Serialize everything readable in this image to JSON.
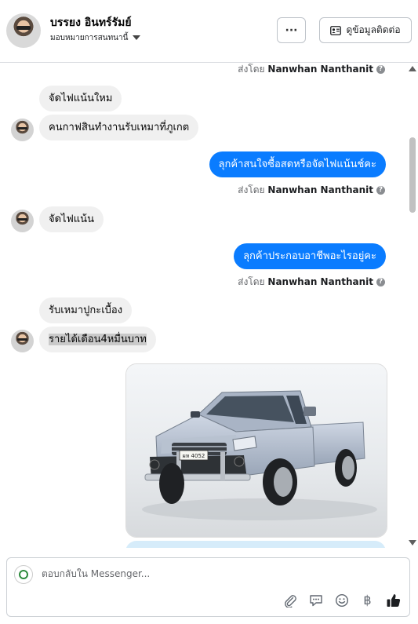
{
  "header": {
    "name": "บรรยง อินทร์รัมย์",
    "assigned_label": "มอบหมายการสนทนานี้",
    "more_label": "···",
    "contact_label": "ดูข้อมูลติดต่อ"
  },
  "messages": {
    "sent_prefix": "ส่งโดย",
    "sender": "Nanwhan Nanthanit",
    "info_glyph": "?",
    "m1": "จัดไฟแน้นใหม",
    "m2": "คนกาฟสินทำงานรับเหมาที่ภูเกต",
    "m3": "ลุกค้าสนใจซื้อสดหรือจัดไฟแน้นช์คะ",
    "m4": "จัดไฟแน้น",
    "m5": "ลุกค้าประกอบอาชีพอะไรอยู่คะ",
    "m6": "รับเหมาปูกะเบื้อง",
    "m7": "รายได้เดือน4หมื่นบาท",
    "plate_text": "ผห 4052"
  },
  "composer": {
    "placeholder": "ตอบกลับใน Messenger...",
    "icons": [
      "paperclip-icon",
      "saved-reply-icon",
      "emoji-icon",
      "baht-icon",
      "thumbs-up-icon"
    ],
    "baht_glyph": "฿"
  },
  "colors": {
    "outgoing": "#0a7cff",
    "incoming": "#f0f0f0",
    "text": "#050505",
    "muted": "#65676b"
  }
}
